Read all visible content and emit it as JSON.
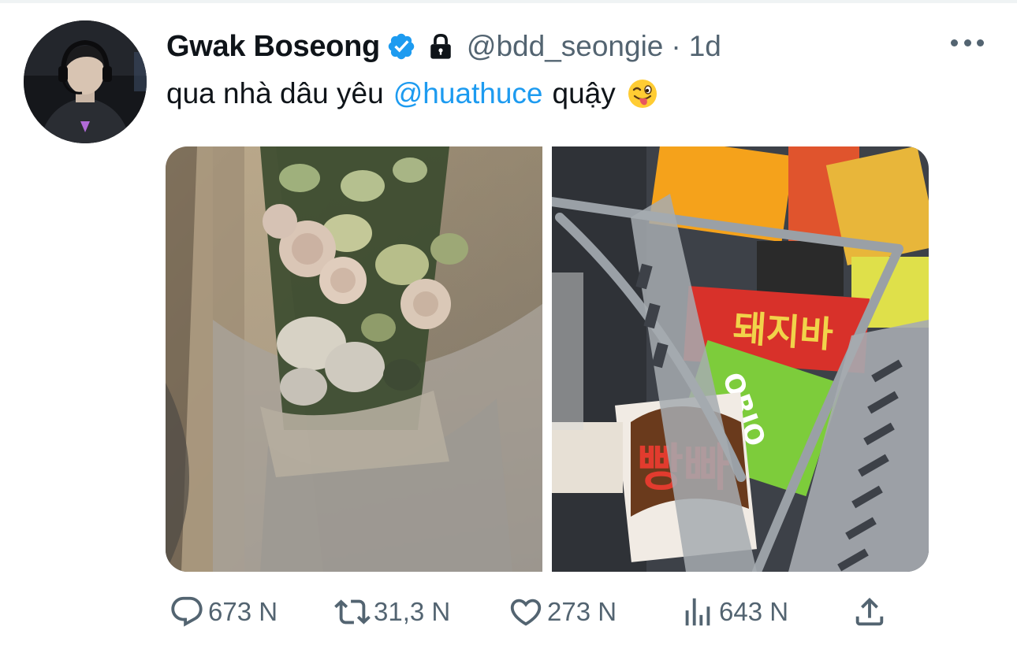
{
  "tweet": {
    "author": {
      "display_name": "Gwak Boseong",
      "handle": "@bdd_seongie",
      "verified": true,
      "protected": true,
      "avatar_icon": "avatar-photo"
    },
    "separator": "·",
    "time": "1d",
    "text": {
      "before": "qua nhà dâu yêu",
      "mention": "@huathuce",
      "after": "quậy",
      "emoji": "winking face with tongue"
    },
    "media": [
      {
        "description_icon": "flower-bouquet-photo"
      },
      {
        "description_icon": "snacks-basket-photo"
      }
    ],
    "metrics": {
      "replies": "673 N",
      "retweets": "31,3 N",
      "likes": "273 N",
      "views": "643 N"
    }
  },
  "colors": {
    "accent": "#1d9bf0",
    "text_primary": "#0f1419",
    "text_secondary": "#536471"
  }
}
